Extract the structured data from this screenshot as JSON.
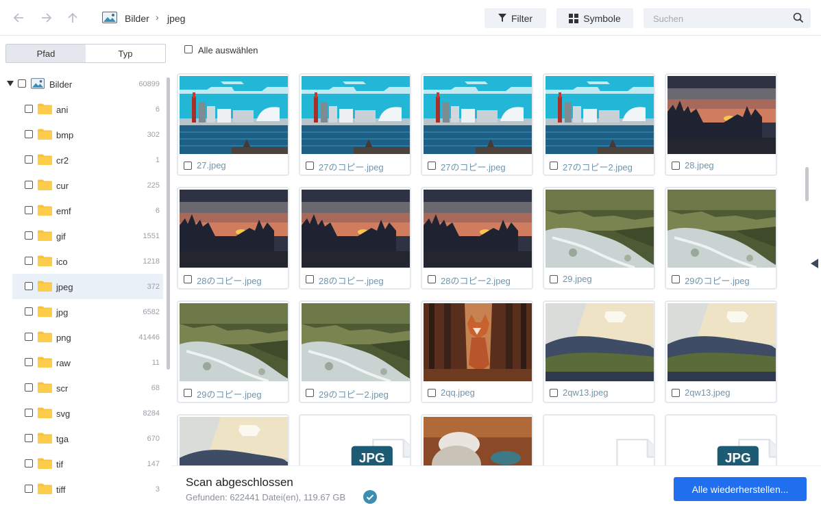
{
  "toolbar": {
    "breadcrumb": [
      "Bilder",
      "jpeg"
    ],
    "filter_label": "Filter",
    "view_label": "Symbole",
    "search_placeholder": "Suchen"
  },
  "sidebar": {
    "tabs": [
      "Pfad",
      "Typ"
    ],
    "active_tab": "Typ",
    "root": {
      "label": "Bilder",
      "count": "60899"
    },
    "items": [
      {
        "label": "ani",
        "count": "6"
      },
      {
        "label": "bmp",
        "count": "302"
      },
      {
        "label": "cr2",
        "count": "1"
      },
      {
        "label": "cur",
        "count": "225"
      },
      {
        "label": "emf",
        "count": "6"
      },
      {
        "label": "gif",
        "count": "1551"
      },
      {
        "label": "ico",
        "count": "1218"
      },
      {
        "label": "jpeg",
        "count": "372"
      },
      {
        "label": "jpg",
        "count": "6582"
      },
      {
        "label": "png",
        "count": "41446"
      },
      {
        "label": "raw",
        "count": "11"
      },
      {
        "label": "scr",
        "count": "68"
      },
      {
        "label": "svg",
        "count": "8284"
      },
      {
        "label": "tga",
        "count": "670"
      },
      {
        "label": "tif",
        "count": "147"
      },
      {
        "label": "tiff",
        "count": "3"
      }
    ],
    "selected_item": "jpeg"
  },
  "main": {
    "select_all_label": "Alle auswählen",
    "files": [
      {
        "name": "27.jpeg",
        "thumb": "city"
      },
      {
        "name": "27のコピー.jpeg",
        "thumb": "city"
      },
      {
        "name": "27のコピー.jpeg",
        "thumb": "city"
      },
      {
        "name": "27のコピー2.jpeg",
        "thumb": "city"
      },
      {
        "name": "28.jpeg",
        "thumb": "sunset"
      },
      {
        "name": "28のコピー.jpeg",
        "thumb": "sunset"
      },
      {
        "name": "28のコピー.jpeg",
        "thumb": "sunset"
      },
      {
        "name": "28のコピー2.jpeg",
        "thumb": "sunset"
      },
      {
        "name": "29.jpeg",
        "thumb": "river"
      },
      {
        "name": "29のコピー.jpeg",
        "thumb": "river"
      },
      {
        "name": "29のコピー.jpeg",
        "thumb": "river"
      },
      {
        "name": "29のコピー2.jpeg",
        "thumb": "river"
      },
      {
        "name": "2qq.jpeg",
        "thumb": "fox"
      },
      {
        "name": "2qw13.jpeg",
        "thumb": "hill"
      },
      {
        "name": "2qw13.jpeg",
        "thumb": "hill"
      },
      {
        "name": "",
        "thumb": "hill"
      },
      {
        "name": "",
        "thumb": "jpg-icon"
      },
      {
        "name": "",
        "thumb": "food"
      },
      {
        "name": "",
        "thumb": "file-icon"
      },
      {
        "name": "",
        "thumb": "jpg-icon"
      }
    ],
    "jpg_badge": "JPG"
  },
  "footer": {
    "title": "Scan abgeschlossen",
    "info": "Gefunden: 622441 Datei(en), 119.67 GB",
    "restore_label": "Alle wiederherstellen..."
  },
  "colors": {
    "accent": "#1f6fee",
    "folder": "#f7c23c",
    "filename": "#6f94ab",
    "check": "#3a8fb0"
  }
}
